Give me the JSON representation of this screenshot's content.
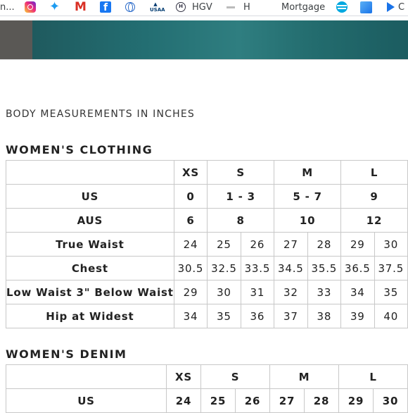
{
  "bookmarks": {
    "first_label": "n...",
    "hgv_label": "HGV",
    "h_label": "H",
    "mortgage_label": "Mortgage",
    "last_label": "C"
  },
  "caption": "BODY MEASUREMENTS IN INCHES",
  "clothing": {
    "title": "WOMEN'S CLOTHING",
    "sizes": [
      "XS",
      "S",
      "M",
      "L"
    ],
    "rows": [
      {
        "label": "US",
        "cells": [
          "0",
          "1 - 3",
          "5 - 7",
          "9"
        ]
      },
      {
        "label": "AUS",
        "cells": [
          "6",
          "8",
          "10",
          "12"
        ]
      },
      {
        "label": "True Waist",
        "cells": [
          "24",
          "25",
          "26",
          "27",
          "28",
          "29",
          "30"
        ]
      },
      {
        "label": "Chest",
        "cells": [
          "30.5",
          "32.5",
          "33.5",
          "34.5",
          "35.5",
          "36.5",
          "37.5"
        ]
      },
      {
        "label": "Low Waist 3\" Below Waist",
        "cells": [
          "29",
          "30",
          "31",
          "32",
          "33",
          "34",
          "35"
        ]
      },
      {
        "label": "Hip at Widest",
        "cells": [
          "34",
          "35",
          "36",
          "37",
          "38",
          "39",
          "40"
        ]
      }
    ]
  },
  "denim": {
    "title": "WOMEN'S DENIM",
    "sizes": [
      "XS",
      "S",
      "M",
      "L"
    ],
    "rows": [
      {
        "label": "US",
        "cells": [
          "24",
          "25",
          "26",
          "27",
          "28",
          "29",
          "30"
        ]
      }
    ]
  }
}
